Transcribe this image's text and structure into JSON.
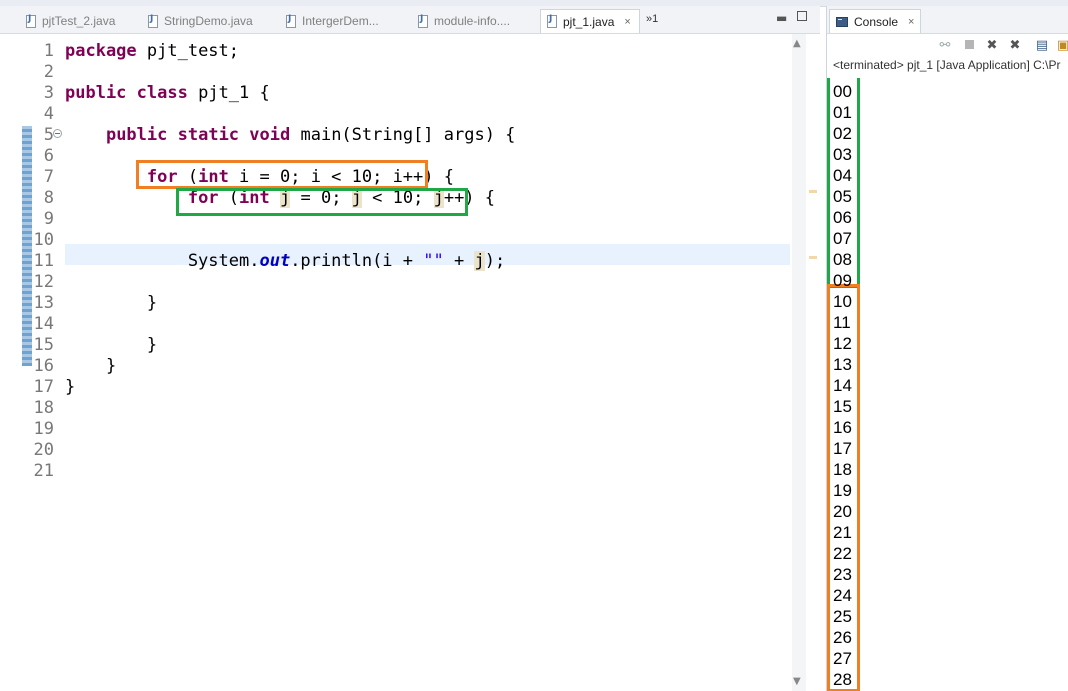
{
  "editor": {
    "tabs": [
      {
        "label": "pjtTest_2.java",
        "active": false
      },
      {
        "label": "StringDemo.java",
        "active": false
      },
      {
        "label": "IntergerDem...",
        "active": false
      },
      {
        "label": "module-info....",
        "active": false
      },
      {
        "label": "pjt_1.java",
        "active": true
      }
    ],
    "overflow_label": "»1",
    "line_numbers": [
      "1",
      "2",
      "3",
      "4",
      "5",
      "6",
      "7",
      "8",
      "9",
      "10",
      "11",
      "12",
      "13",
      "14",
      "15",
      "16",
      "17",
      "18",
      "19",
      "20",
      "21"
    ],
    "highlight_colors": {
      "outer_loop": "#f07f23",
      "inner_loop": "#21a846"
    }
  },
  "console": {
    "tab_label": "Console",
    "status": "<terminated> pjt_1 [Java Application] C:\\Pr",
    "output": [
      "00",
      "01",
      "02",
      "03",
      "04",
      "05",
      "06",
      "07",
      "08",
      "09",
      "10",
      "11",
      "12",
      "13",
      "14",
      "15",
      "16",
      "17",
      "18",
      "19",
      "20",
      "21",
      "22",
      "23",
      "24",
      "25",
      "26",
      "27",
      "28"
    ],
    "highlight_colors": {
      "first_group": "#21a846",
      "second_group": "#f07f23"
    }
  },
  "icons": {
    "tab_close": "×",
    "minimize": "▬",
    "scroll_up": "▲",
    "scroll_down": "▼",
    "toolbar": [
      "link-icon",
      "terminate-icon",
      "remove-launch-icon",
      "remove-all-icon",
      "clear-console-icon",
      "scroll-lock-icon"
    ]
  }
}
